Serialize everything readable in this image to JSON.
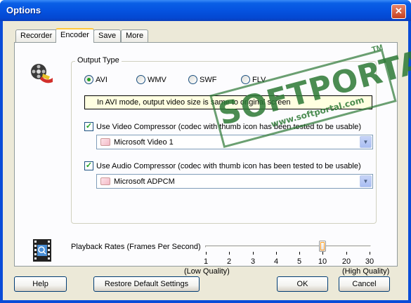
{
  "window": {
    "title": "Options",
    "close_glyph": "✕"
  },
  "tabs": [
    {
      "label": "Recorder",
      "active": false
    },
    {
      "label": "Encoder",
      "active": true
    },
    {
      "label": "Save",
      "active": false
    },
    {
      "label": "More",
      "active": false
    }
  ],
  "output_type": {
    "label": "Output Type",
    "options": [
      "AVI",
      "WMV",
      "SWF",
      "FLV"
    ],
    "selected": "AVI"
  },
  "info_text": "In AVI mode, output video size is same to original screen",
  "video_compressor": {
    "label": "Use Video Compressor  (codec with thumb icon has been tested to be usable)",
    "checked": true,
    "value": "Microsoft Video 1"
  },
  "audio_compressor": {
    "label": "Use Audio Compressor  (codec with thumb icon has been tested to be usable)",
    "checked": true,
    "value": "Microsoft ADPCM"
  },
  "playback": {
    "label": "Playback Rates (Frames Per Second)",
    "ticks": [
      "1",
      "2",
      "3",
      "4",
      "5",
      "10",
      "20",
      "30"
    ],
    "selected": "10",
    "low_label": "(Low Quality)",
    "high_label": "(High Quality)"
  },
  "buttons": {
    "help": "Help",
    "restore": "Restore Default Settings",
    "ok": "OK",
    "cancel": "Cancel"
  },
  "watermark": {
    "main": "SOFTPORTAL",
    "sub": "www.softportal.com",
    "tm": "TM"
  },
  "icons": {
    "film-reel": "film-reel-icon",
    "film-frame": "film-frame-icon"
  }
}
